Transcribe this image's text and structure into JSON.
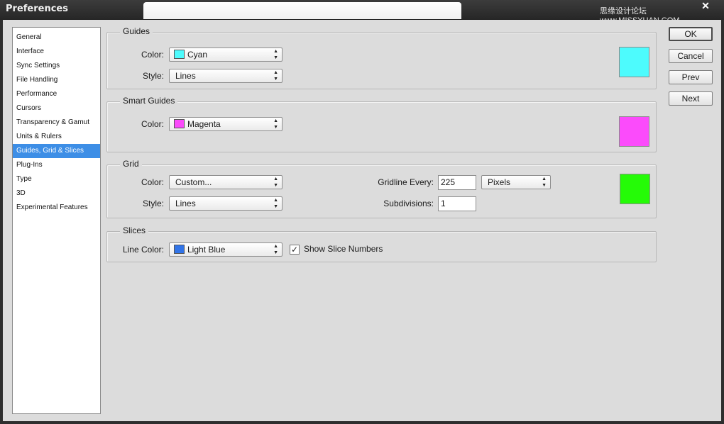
{
  "window": {
    "title": "Preferences",
    "watermark": "思缘设计论坛 www.MISSYUAN.COM",
    "close_glyph": "✕"
  },
  "sidebar": {
    "items": [
      {
        "label": "General"
      },
      {
        "label": "Interface"
      },
      {
        "label": "Sync Settings"
      },
      {
        "label": "File Handling"
      },
      {
        "label": "Performance"
      },
      {
        "label": "Cursors"
      },
      {
        "label": "Transparency & Gamut"
      },
      {
        "label": "Units & Rulers"
      },
      {
        "label": "Guides, Grid & Slices",
        "selected": true
      },
      {
        "label": "Plug-Ins"
      },
      {
        "label": "Type"
      },
      {
        "label": "3D"
      },
      {
        "label": "Experimental Features"
      }
    ]
  },
  "guides": {
    "title": "Guides",
    "color_label": "Color:",
    "color_value": "Cyan",
    "color_hex": "#4dfbfd",
    "style_label": "Style:",
    "style_value": "Lines"
  },
  "smart_guides": {
    "title": "Smart Guides",
    "color_label": "Color:",
    "color_value": "Magenta",
    "color_hex": "#fb4bfb"
  },
  "grid": {
    "title": "Grid",
    "color_label": "Color:",
    "color_value": "Custom...",
    "color_hex": "#25fb07",
    "style_label": "Style:",
    "style_value": "Lines",
    "gridline_label": "Gridline Every:",
    "gridline_value": "225",
    "unit_value": "Pixels",
    "subdivisions_label": "Subdivisions:",
    "subdivisions_value": "1"
  },
  "slices": {
    "title": "Slices",
    "line_color_label": "Line Color:",
    "line_color_value": "Light Blue",
    "line_color_hex": "#3174e8",
    "show_numbers_label": "Show Slice Numbers",
    "show_numbers_checked": true,
    "check_glyph": "✓"
  },
  "buttons": {
    "ok": "OK",
    "cancel": "Cancel",
    "prev": "Prev",
    "next": "Next"
  },
  "icons": {
    "dropdown_arrows": [
      "▲",
      "▼"
    ]
  }
}
